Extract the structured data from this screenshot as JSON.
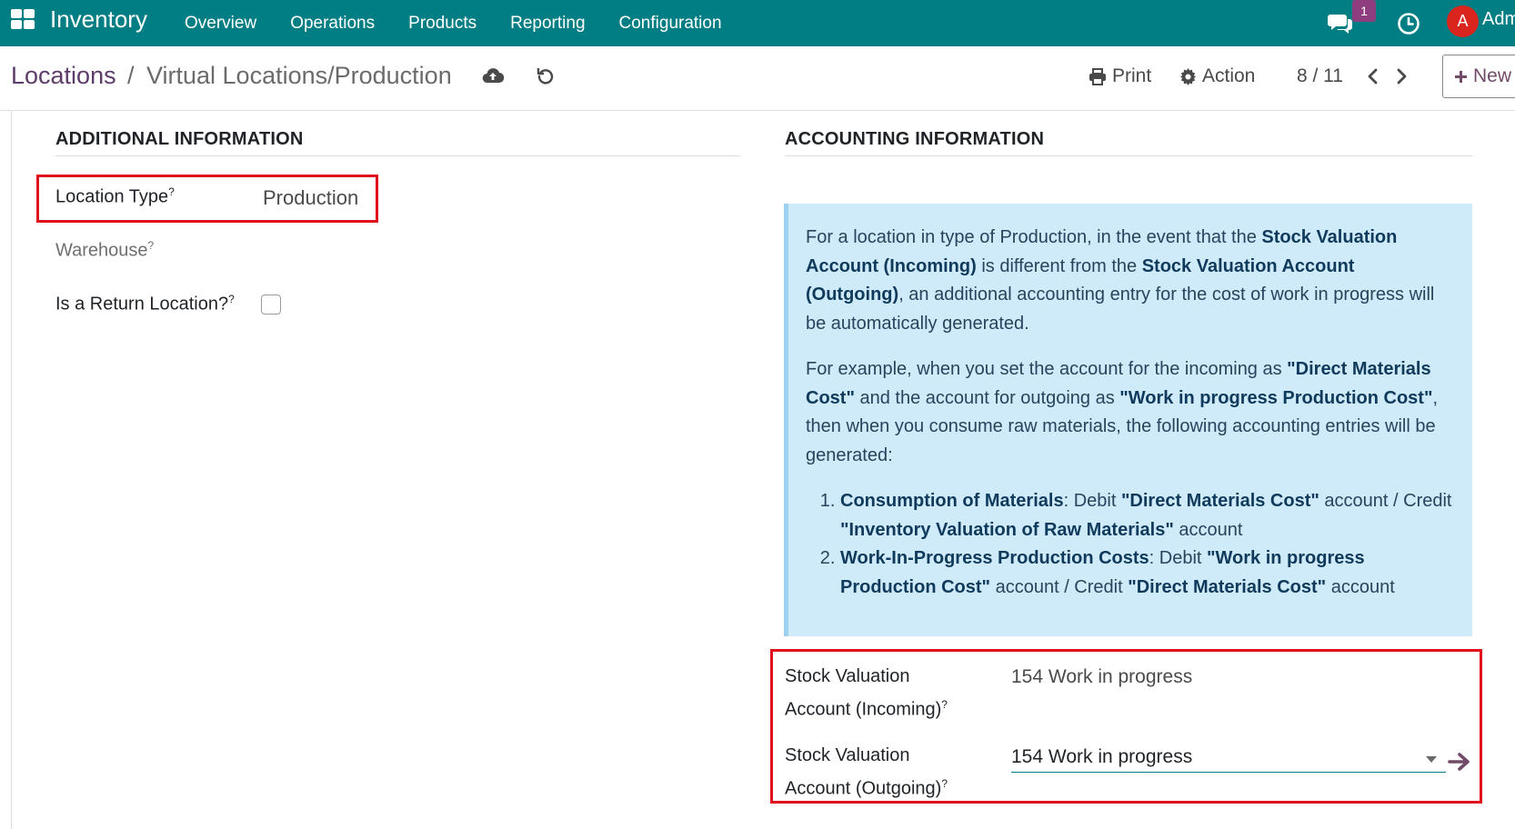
{
  "app": {
    "name": "Inventory",
    "icons": {
      "apps": "apps-grid-icon",
      "chat": "chat-icon",
      "activity": "clock-icon"
    },
    "chat_badge": "1",
    "user_initial": "A",
    "user_name": "Adm"
  },
  "menu": [
    "Overview",
    "Operations",
    "Products",
    "Reporting",
    "Configuration"
  ],
  "breadcrumb": {
    "parent": "Locations",
    "separator": "/",
    "current": "Virtual Locations/Production"
  },
  "toolbar": {
    "print_label": "Print",
    "action_label": "Action",
    "pager": "8 / 11",
    "new_label": "New"
  },
  "additional": {
    "title": "ADDITIONAL INFORMATION",
    "location_type_label": "Location Type",
    "location_type_value": "Production",
    "warehouse_label": "Warehouse",
    "return_label": "Is a Return Location?",
    "return_checked": false,
    "help_mark": "?"
  },
  "accounting": {
    "title": "ACCOUNTING INFORMATION",
    "info_p1": [
      {
        "t": "For a location in type of Production, in the event that the ",
        "b": false
      },
      {
        "t": "Stock Valuation Account (Incoming)",
        "b": true
      },
      {
        "t": " is different from the ",
        "b": false
      },
      {
        "t": "Stock Valuation Account (Outgoing)",
        "b": true
      },
      {
        "t": ", an additional accounting entry for the cost of work in progress will be automatically generated.",
        "b": false
      }
    ],
    "info_p2": [
      {
        "t": "For example, when you set the account for the incoming as ",
        "b": false
      },
      {
        "t": "\"Direct Materials Cost\"",
        "b": true
      },
      {
        "t": " and the account for outgoing as ",
        "b": false
      },
      {
        "t": "\"Work in progress Production Cost\"",
        "b": true
      },
      {
        "t": ", then when you consume raw materials, the following accounting entries will be generated:",
        "b": false
      }
    ],
    "info_list": [
      [
        {
          "t": "Consumption of Materials",
          "b": true
        },
        {
          "t": ": Debit ",
          "b": false
        },
        {
          "t": "\"Direct Materials Cost\"",
          "b": true
        },
        {
          "t": " account / Credit ",
          "b": false
        },
        {
          "t": "\"Inventory Valuation of Raw Materials\"",
          "b": true
        },
        {
          "t": " account",
          "b": false
        }
      ],
      [
        {
          "t": "Work-In-Progress Production Costs",
          "b": true
        },
        {
          "t": ": Debit ",
          "b": false
        },
        {
          "t": "\"Work in progress Production Cost\"",
          "b": true
        },
        {
          "t": " account / Credit ",
          "b": false
        },
        {
          "t": "\"Direct Materials Cost\"",
          "b": true
        },
        {
          "t": " account",
          "b": false
        }
      ]
    ],
    "incoming_label_1": "Stock Valuation",
    "incoming_label_2": "Account (Incoming)",
    "incoming_value": "154 Work in progress",
    "outgoing_label_1": "Stock Valuation",
    "outgoing_label_2": "Account (Outgoing)",
    "outgoing_value": "154 Work in progress"
  },
  "colors": {
    "navbar": "#017e84",
    "brand_purple": "#714b67",
    "highlight_red": "#e0101c",
    "info_bg": "#cfeaf9"
  }
}
